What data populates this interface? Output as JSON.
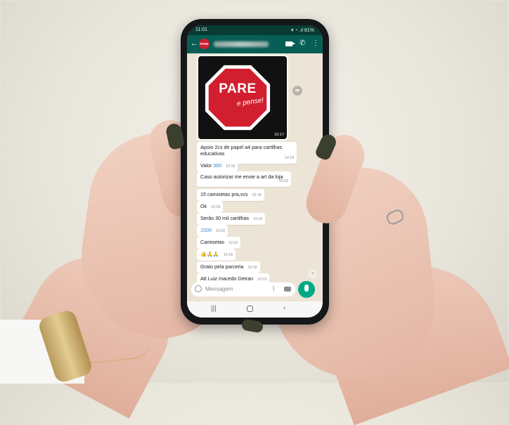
{
  "status_bar": {
    "time": "11:01",
    "icons": "▾ ◔ .ıl 81%"
  },
  "header": {
    "back_icon": "back-arrow-icon",
    "avatar_text": "PARE",
    "contact_name": "▇▇▇▇▇▇▇▇▇▇"
  },
  "image_message": {
    "sign_word": "PARE",
    "sign_tagline": "e pense!",
    "time": "10:17"
  },
  "messages": [
    {
      "text": "Apoio 2cx de papel a4 para cartilhas educativas",
      "time": "10:18"
    },
    {
      "prefix": "Valor ",
      "highlight": "360",
      "time": "10:18"
    },
    {
      "text": "Caso autorizar me envie a art da loja",
      "time": "10:18"
    },
    {
      "text": "15 camisetas pra,vcs",
      "time": "10:18"
    },
    {
      "text": "Ok",
      "time": "10:18"
    },
    {
      "text": "Serão 30 mil cartilhas",
      "time": "10:18"
    },
    {
      "highlight": "1000",
      "time": "10:18"
    },
    {
      "text": "Camisetas",
      "time": "10:18"
    },
    {
      "text": "👍🙏🙏",
      "time": "10:18"
    },
    {
      "text": "Grato pela parceria",
      "time": "10:19"
    },
    {
      "text": "Att Luiz macedo Detran",
      "time": "10:19"
    }
  ],
  "input": {
    "placeholder": "Mensagem"
  },
  "nav": {
    "recents": "|||",
    "back": "‹"
  },
  "colors": {
    "header": "#075e54",
    "accent": "#00a884",
    "stop_sign": "#d11f2f",
    "chat_bg": "#ece4d6"
  }
}
